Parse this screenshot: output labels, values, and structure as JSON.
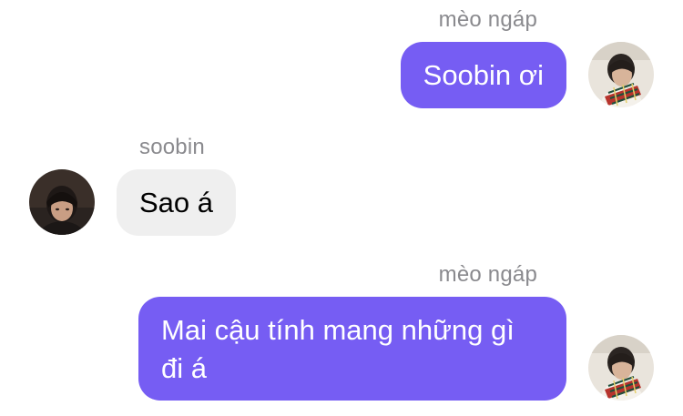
{
  "messages": [
    {
      "sender": "mèo ngáp",
      "text": "Soobin ơi"
    },
    {
      "sender": "soobin",
      "text": "Sao á"
    },
    {
      "sender": "mèo ngáp",
      "text_lines": [
        "Mai cậu tính mang những gì",
        "đi á"
      ]
    }
  ],
  "avatars": {
    "self": "avatar-photo-plaid-scarf",
    "other": "avatar-photo-dark-hair"
  },
  "colors": {
    "outgoing_bubble": "#765df3",
    "incoming_bubble": "#efefef",
    "sender_name": "#8a8a8e"
  }
}
